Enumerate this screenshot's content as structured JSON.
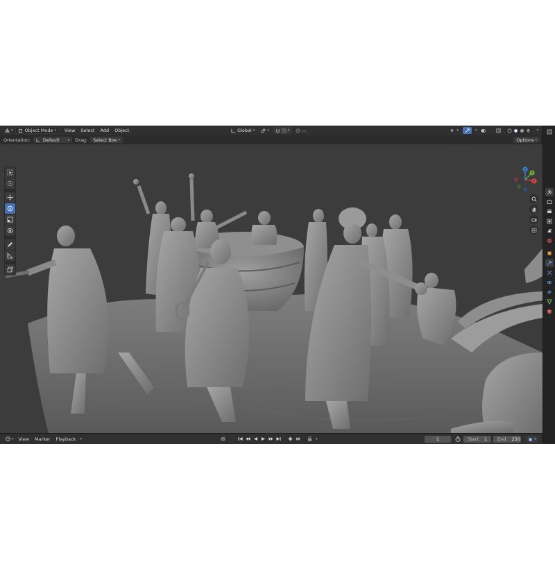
{
  "header": {
    "mode_label": "Object Mode",
    "menus": [
      "View",
      "Select",
      "Add",
      "Object"
    ],
    "transform_orientation": "Global"
  },
  "tool_settings": {
    "orientation_label": "Orientation:",
    "orientation_value": "Default",
    "drag_label": "Drag:",
    "drag_value": "Select Box",
    "options_label": "Options"
  },
  "gizmo": {
    "z_label": "Z",
    "y_label": "Y",
    "x_label": "X",
    "colors": {
      "x": "#e64553",
      "y": "#6bb33a",
      "z": "#3d8bdf"
    }
  },
  "timeline": {
    "menus": [
      "View",
      "Marker",
      "Playback"
    ],
    "current_frame": "1",
    "start_label": "Start",
    "start_value": "1",
    "end_label": "End",
    "end_value": "250"
  },
  "colors": {
    "accent": "#4772b3",
    "viewport_bg": "#3c3c3c",
    "header_bg": "#303030"
  }
}
